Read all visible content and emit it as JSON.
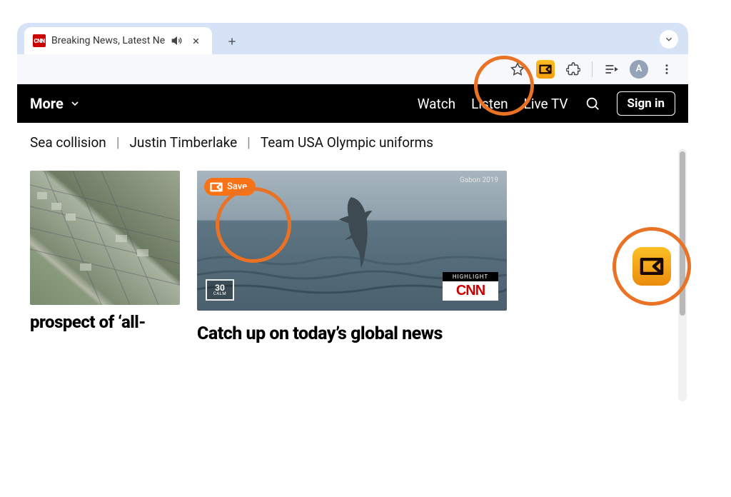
{
  "browser": {
    "tab": {
      "favicon_text": "CNN",
      "title": "Breaking News, Latest Ne"
    },
    "avatar_initial": "A"
  },
  "site_nav": {
    "more_label": "More",
    "links": [
      "Watch",
      "Listen",
      "Live TV"
    ],
    "signin_label": "Sign in"
  },
  "trending": {
    "items": [
      "Sea collision",
      "Justin Timberlake",
      "Team USA Olympic uniforms"
    ]
  },
  "save_button": {
    "label": "Save"
  },
  "video_overlay": {
    "credit": "Gabon 2019",
    "badge_number": "30",
    "badge_small": "CALM",
    "highlight_label": "HIGHLIGHT",
    "network": "CNN"
  },
  "headlines": {
    "left": "prospect of ‘all-",
    "right": "Catch up on today’s global news"
  },
  "colors": {
    "accent_orange": "#f97316",
    "annotation": "#ea7224",
    "cnn_red": "#cc0000"
  }
}
